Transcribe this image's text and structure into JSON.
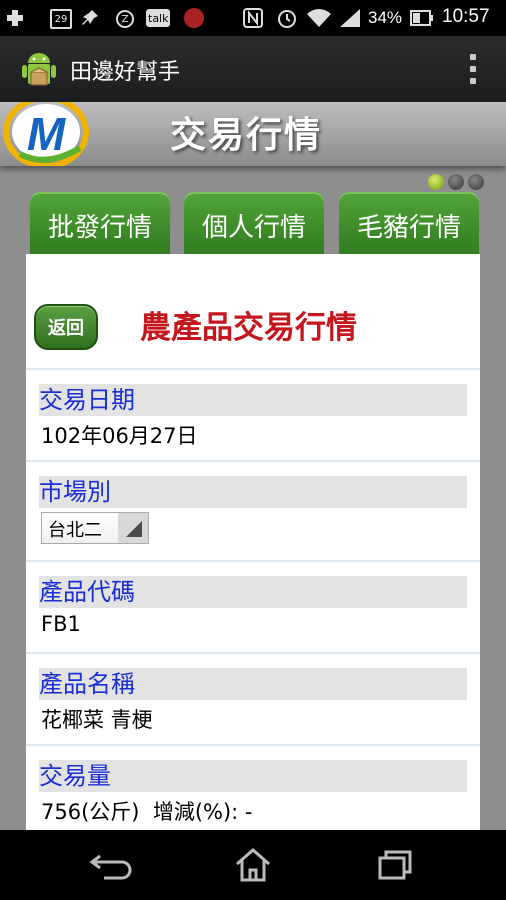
{
  "status_bar": {
    "calendar_day": "29",
    "talk_label": "talk",
    "z_label": "Z",
    "battery_percent": "34%",
    "time": "10:57",
    "icons": [
      "plus-icon",
      "calendar-icon",
      "pin-icon",
      "z-icon",
      "talk-icon",
      "app-red-icon",
      "nfc-icon",
      "alarm-icon",
      "wifi-icon",
      "signal-icon",
      "battery-icon"
    ]
  },
  "app_bar": {
    "title": "田邊好幫手",
    "icon": "android-icon",
    "overflow_icon": "overflow-menu-icon"
  },
  "banner": {
    "title": "交易行情",
    "logo_letter": "M"
  },
  "page_indicator": {
    "count": 3,
    "active_index": 0
  },
  "tabs": [
    {
      "label": "批發行情"
    },
    {
      "label": "個人行情"
    },
    {
      "label": "毛豬行情"
    }
  ],
  "panel": {
    "back_label": "返回",
    "title": "農產品交易行情",
    "fields": {
      "date": {
        "label": "交易日期",
        "value": "102年06月27日"
      },
      "market": {
        "label": "市場別",
        "selected": "台北二"
      },
      "code": {
        "label": "產品代碼",
        "value": "FB1"
      },
      "name": {
        "label": "產品名稱",
        "value": "花椰菜 青梗"
      },
      "volume": {
        "label": "交易量",
        "value": "756(公斤)  增減(%): -"
      }
    }
  },
  "colors": {
    "tab_green": "#3f8f2a",
    "title_red": "#c4161c",
    "label_blue": "#1a2fd4"
  },
  "nav_bar": {
    "icons": [
      "back-icon",
      "home-icon",
      "recent-apps-icon"
    ]
  }
}
